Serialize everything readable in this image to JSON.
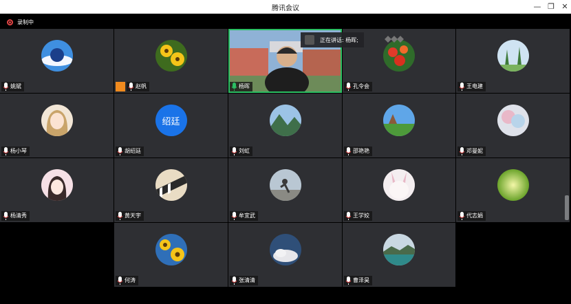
{
  "window": {
    "title": "腾讯会议"
  },
  "recording": {
    "label": "录制中"
  },
  "speaking": {
    "label": "正在讲话: 杨晖;"
  },
  "participants": [
    {
      "name": "姚斌"
    },
    {
      "name": "赵帆"
    },
    {
      "name": "杨晖"
    },
    {
      "name": "孔令会"
    },
    {
      "name": "王电建"
    },
    {
      "name": "杨小琴"
    },
    {
      "name": "胡绍廷",
      "avatar_text": "绍廷"
    },
    {
      "name": "刘虹"
    },
    {
      "name": "邵艳艳"
    },
    {
      "name": "邓曼妮"
    },
    {
      "name": "杨清秀"
    },
    {
      "name": "黄天宇"
    },
    {
      "name": "牟宜武"
    },
    {
      "name": "王学姣"
    },
    {
      "name": "代志娟"
    },
    {
      "name": "何涛"
    },
    {
      "name": "张清清"
    },
    {
      "name": "曹泽昊"
    }
  ],
  "colors": {
    "tile_bg": "#2e2f33",
    "active_border": "#2bbf63",
    "host_badge": "#f08a1e",
    "text_avatar": "#1a73e8"
  }
}
